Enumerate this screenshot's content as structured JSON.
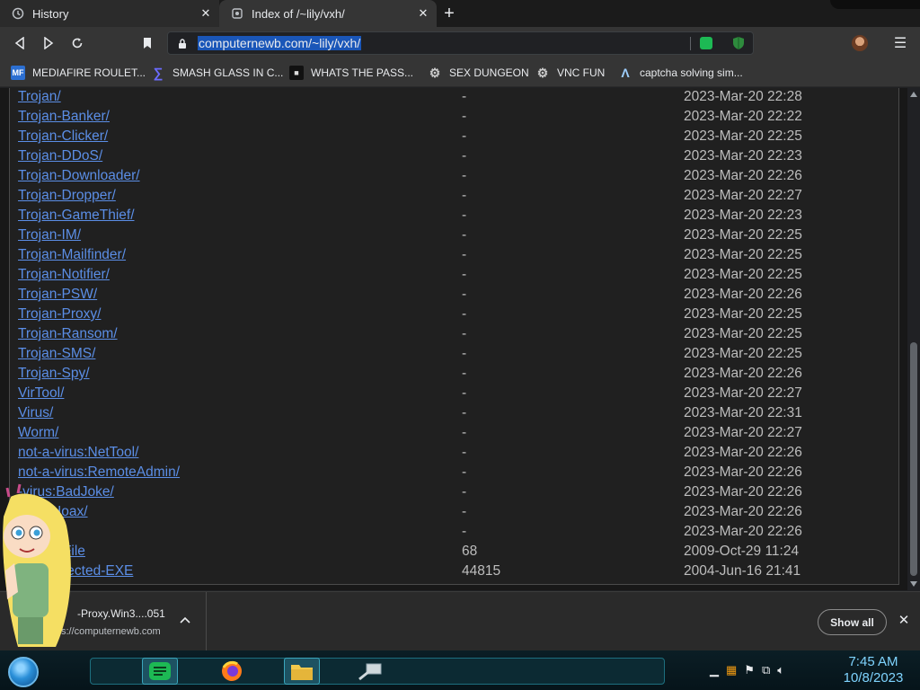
{
  "tabs": [
    {
      "title": "History",
      "icon": "history-icon"
    },
    {
      "title": "Index of /~lily/vxh/",
      "icon": "page-favicon-icon"
    }
  ],
  "toolbar": {
    "url": "computernewb.com/~lily/vxh/"
  },
  "bookmarks": [
    {
      "label": "MEDIAFIRE ROULET...",
      "icon": "MF"
    },
    {
      "label": "SMASH GLASS IN C...",
      "icon": "∑"
    },
    {
      "label": "WHATS THE PASS...",
      "icon": "■"
    },
    {
      "label": "SEX DUNGEON",
      "icon": "⚙"
    },
    {
      "label": "VNC FUN",
      "icon": "⚙"
    },
    {
      "label": "captcha solving sim...",
      "icon": "Λ"
    }
  ],
  "listing": [
    {
      "name": "Trojan/",
      "size": "-",
      "date": "2023-Mar-20 22:28"
    },
    {
      "name": "Trojan-Banker/",
      "size": "-",
      "date": "2023-Mar-20 22:22"
    },
    {
      "name": "Trojan-Clicker/",
      "size": "-",
      "date": "2023-Mar-20 22:25"
    },
    {
      "name": "Trojan-DDoS/",
      "size": "-",
      "date": "2023-Mar-20 22:23"
    },
    {
      "name": "Trojan-Downloader/",
      "size": "-",
      "date": "2023-Mar-20 22:26"
    },
    {
      "name": "Trojan-Dropper/",
      "size": "-",
      "date": "2023-Mar-20 22:27"
    },
    {
      "name": "Trojan-GameThief/",
      "size": "-",
      "date": "2023-Mar-20 22:23"
    },
    {
      "name": "Trojan-IM/",
      "size": "-",
      "date": "2023-Mar-20 22:25"
    },
    {
      "name": "Trojan-Mailfinder/",
      "size": "-",
      "date": "2023-Mar-20 22:25"
    },
    {
      "name": "Trojan-Notifier/",
      "size": "-",
      "date": "2023-Mar-20 22:25"
    },
    {
      "name": "Trojan-PSW/",
      "size": "-",
      "date": "2023-Mar-20 22:26"
    },
    {
      "name": "Trojan-Proxy/",
      "size": "-",
      "date": "2023-Mar-20 22:25"
    },
    {
      "name": "Trojan-Ransom/",
      "size": "-",
      "date": "2023-Mar-20 22:25"
    },
    {
      "name": "Trojan-SMS/",
      "size": "-",
      "date": "2023-Mar-20 22:25"
    },
    {
      "name": "Trojan-Spy/",
      "size": "-",
      "date": "2023-Mar-20 22:26"
    },
    {
      "name": "VirTool/",
      "size": "-",
      "date": "2023-Mar-20 22:27"
    },
    {
      "name": "Virus/",
      "size": "-",
      "date": "2023-Mar-20 22:31"
    },
    {
      "name": "Worm/",
      "size": "-",
      "date": "2023-Mar-20 22:27"
    },
    {
      "name": "not-a-virus:NetTool/",
      "size": "-",
      "date": "2023-Mar-20 22:26"
    },
    {
      "name": "not-a-virus:RemoteAdmin/",
      "size": "-",
      "date": "2023-Mar-20 22:26"
    },
    {
      "name": "-virus:BadJoke/",
      "size": "-",
      "date": "2023-Mar-20 22:26"
    },
    {
      "name": "virus:Hoax/",
      "size": "-",
      "date": "2023-Mar-20 22:26"
    },
    {
      "name": "",
      "size": "-",
      "date": "2023-Mar-20 22:26"
    },
    {
      "name": "R-Test-File",
      "size": "68",
      "date": "2009-Oct-29 11:24"
    },
    {
      "name": "ord-protected-EXE",
      "size": "44815",
      "date": "2004-Jun-16 21:41"
    }
  ],
  "download": {
    "name": "-Proxy.Win3....051",
    "host": "s://computernewb.com",
    "show_all": "Show all"
  },
  "taskbar": {
    "time": "7:45 AM",
    "date": "10/8/2023"
  },
  "colors": {
    "link": "#5b8ee6",
    "url_highlight": "#1a56b8",
    "clock": "#7fd4ff"
  }
}
